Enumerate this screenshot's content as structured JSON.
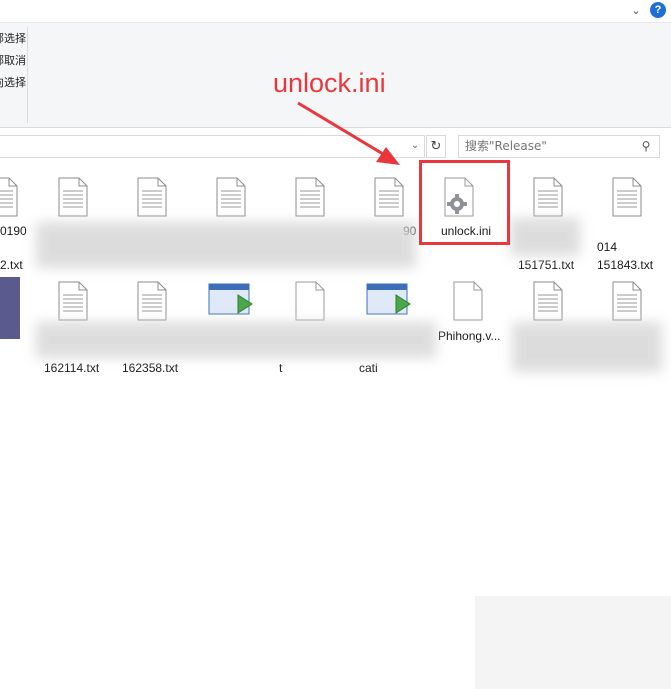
{
  "titlebar": {
    "expand_icon": "chevron-down-icon",
    "help_icon": "help-icon",
    "help_label": "?"
  },
  "ribbon": {
    "items": [
      {
        "label": "全部选择"
      },
      {
        "label": "全部取消"
      },
      {
        "label": "反向选择"
      }
    ]
  },
  "address": {
    "refresh_icon": "refresh-icon"
  },
  "search": {
    "placeholder": "搜索\"Release\"",
    "icon": "search-icon"
  },
  "annotation": {
    "text": "unlock.ini",
    "color": "#e8383d"
  },
  "files": [
    {
      "label": "0190"
    },
    {
      "label": "2.txt"
    },
    {
      "label": "90"
    },
    {
      "label": "unlock.ini"
    },
    {
      "label": "151751.txt"
    },
    {
      "label": "014"
    },
    {
      "label": "151843.txt"
    },
    {
      "label": "162114.txt"
    },
    {
      "label": "162358.txt"
    },
    {
      "label": "Phihong.v..."
    },
    {
      "label": "t"
    },
    {
      "label": "cati"
    }
  ]
}
